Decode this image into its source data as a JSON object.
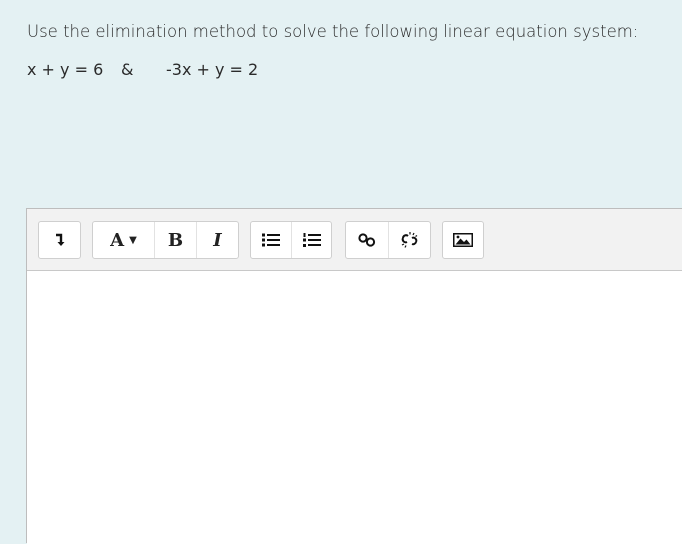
{
  "question": {
    "prompt": "Use the elimination method to solve the following linear equation system:",
    "equation1": "x + y = 6",
    "connector": "&",
    "equation2": "-3x + y = 2"
  },
  "toolbar": {
    "font_label": "A",
    "bold_label": "B",
    "italic_label": "I",
    "icons": [
      "collapse-icon",
      "font-color-icon",
      "bold-icon",
      "italic-icon",
      "bulleted-list-icon",
      "numbered-list-icon",
      "link-icon",
      "unlink-icon",
      "image-icon"
    ]
  },
  "editor": {
    "content": ""
  }
}
